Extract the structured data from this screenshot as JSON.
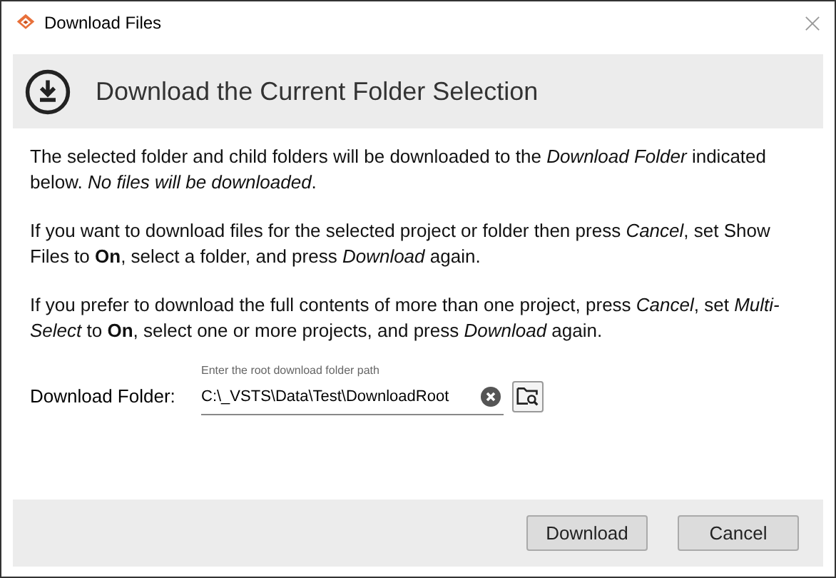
{
  "window": {
    "title": "Download Files"
  },
  "header": {
    "title": "Download the Current Folder Selection"
  },
  "paragraphs": [
    "The selected folder and child folders will be downloaded to the *Download Folder* indicated below. *No files will be downloaded*.",
    "If you want to download files for the selected project or folder then press *Cancel*, set Show Files to **On**, select a folder, and press *Download* again.",
    "If you prefer to download the full contents of more than one project, press *Cancel*, set *Multi-Select* to **On**, select one or more projects, and press *Download* again."
  ],
  "folder": {
    "label": "Download Folder:",
    "hint": "Enter the root download folder path",
    "value": "C:\\_VSTS\\Data\\Test\\DownloadRoot"
  },
  "buttons": [
    "Download",
    "Cancel"
  ]
}
